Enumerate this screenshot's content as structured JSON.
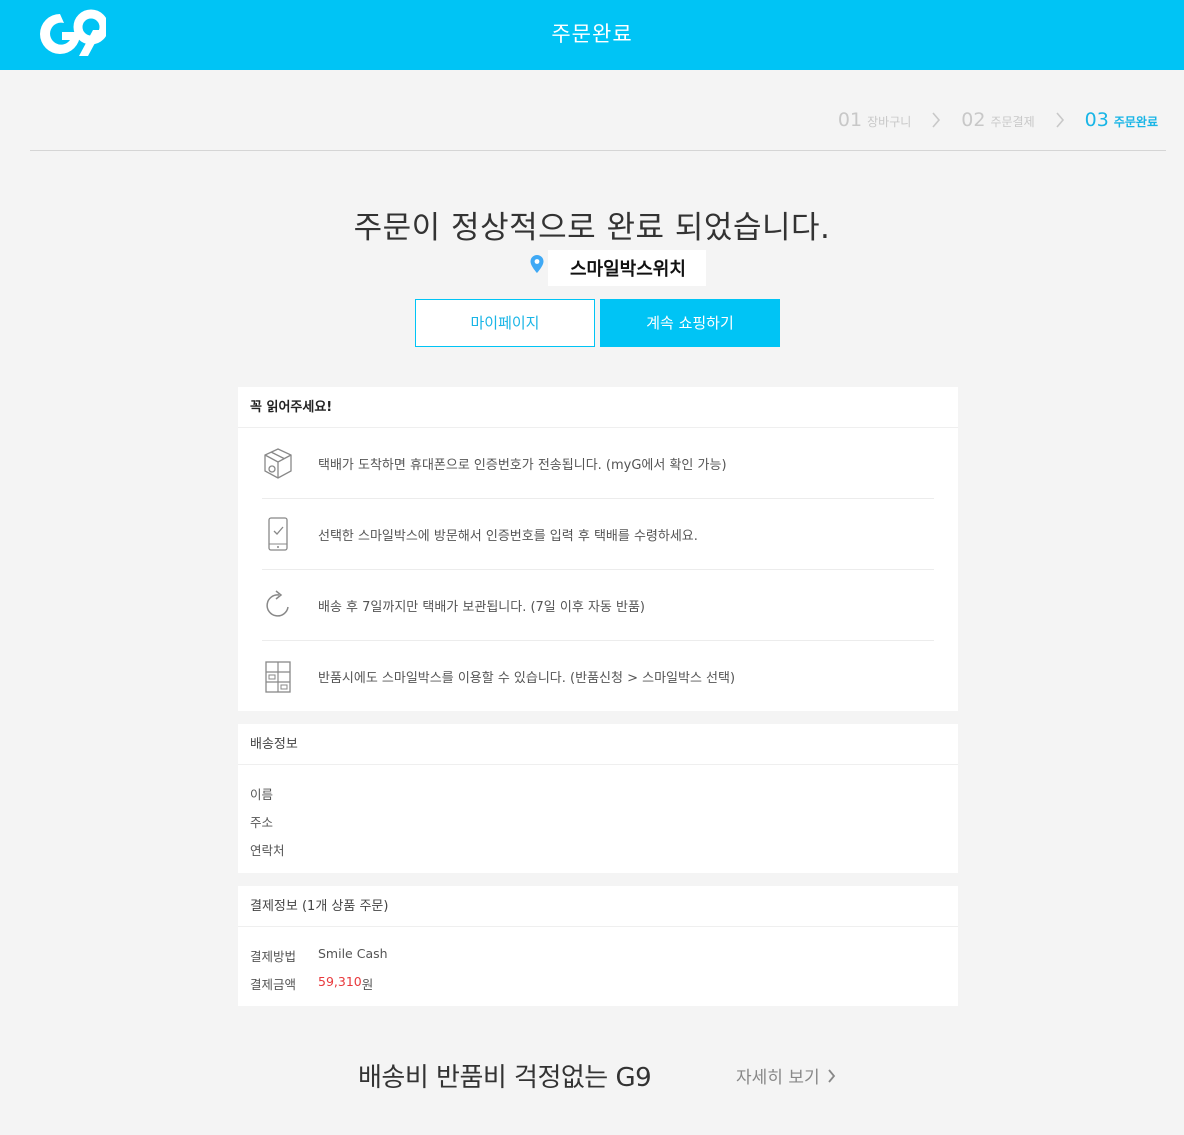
{
  "header": {
    "logo_text": "G9",
    "title": "주문완료"
  },
  "steps": [
    {
      "num": "01",
      "label": "장바구니",
      "active": false
    },
    {
      "num": "02",
      "label": "주문결제",
      "active": false
    },
    {
      "num": "03",
      "label": "주문완료",
      "active": true
    }
  ],
  "main": {
    "headline": "주문이 정상적으로 완료 되었습니다.",
    "location_name": "스마일박스위치",
    "mypage_button": "마이페이지",
    "continue_button": "계속 쇼핑하기"
  },
  "notice": {
    "title": "꼭 읽어주세요!",
    "items": [
      {
        "icon": "package-icon",
        "text": "택배가 도착하면 휴대폰으로 인증번호가 전송됩니다. (myG에서 확인 가능)"
      },
      {
        "icon": "phone-check-icon",
        "text": "선택한 스마일박스에 방문해서 인증번호를 입력 후 택배를 수령하세요."
      },
      {
        "icon": "refresh-icon",
        "text": "배송 후 7일까지만 택배가 보관됩니다. (7일 이후 자동 반품)"
      },
      {
        "icon": "locker-icon",
        "text": "반품시에도 스마일박스를 이용할 수 있습니다. (반품신청 > 스마일박스 선택)"
      }
    ]
  },
  "delivery": {
    "title": "배송정보",
    "name_label": "이름",
    "address_label": "주소",
    "contact_label": "연락처"
  },
  "payment": {
    "title": "결제정보 (1개 상품 주문)",
    "method_label": "결제방법",
    "method_value": "Smile Cash",
    "amount_label": "결제금액",
    "amount_value": "59,310",
    "amount_unit": "원"
  },
  "banner": {
    "title": "배송비 반품비 걱정없는 G9",
    "link": "자세히 보기"
  },
  "colors": {
    "brand": "#00c4f5",
    "active_step": "#19b5e6",
    "price": "#e8393c"
  }
}
